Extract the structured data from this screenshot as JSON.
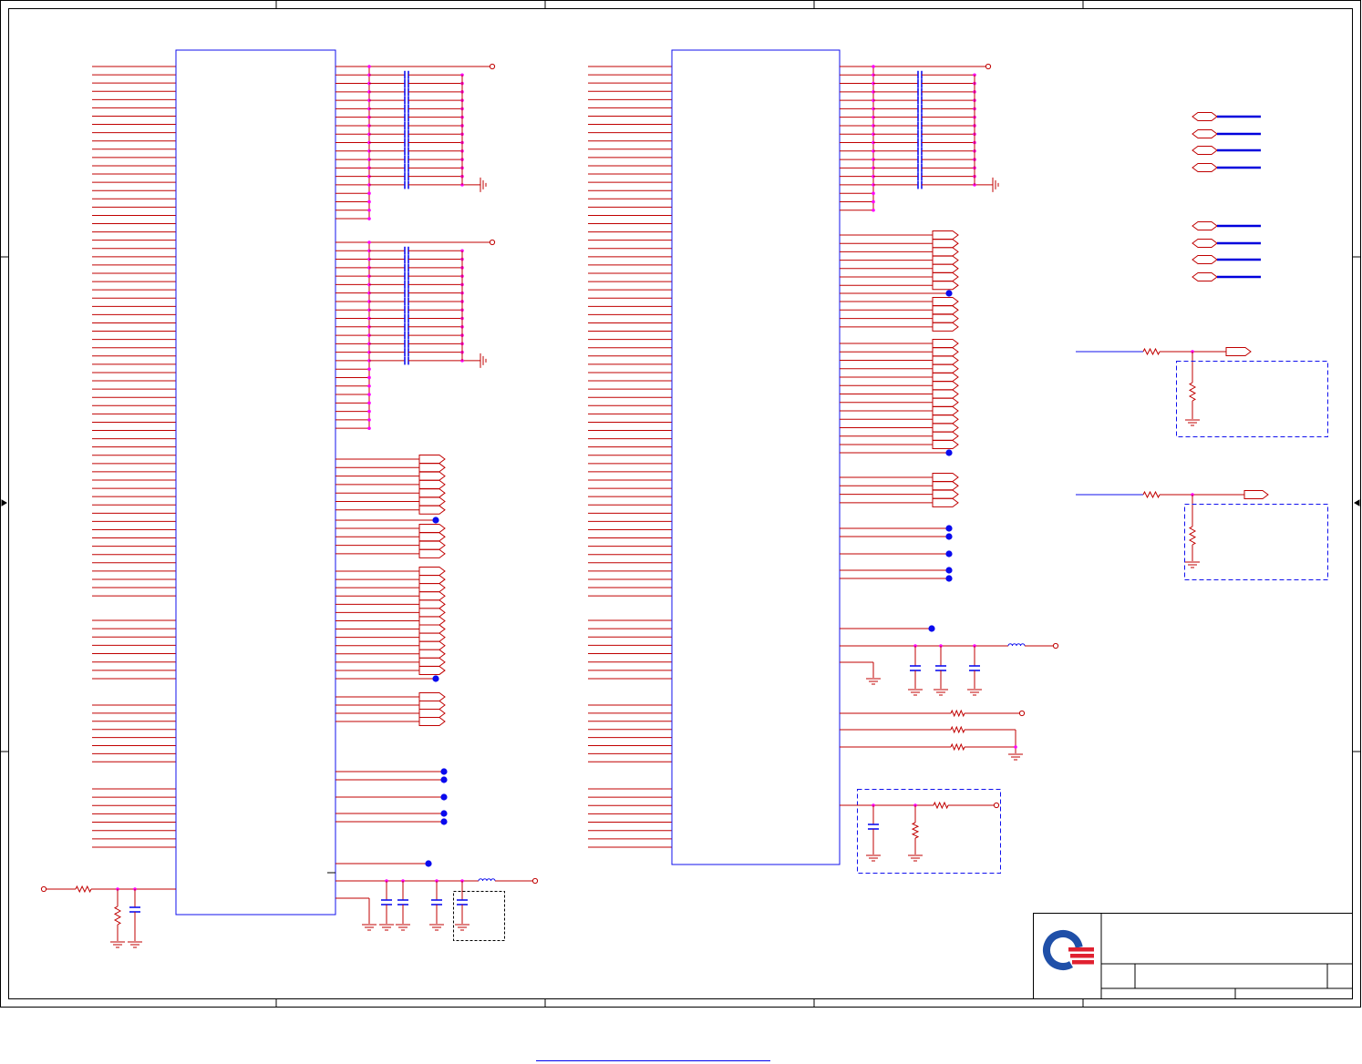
{
  "colors": {
    "wire": "#c00000",
    "component_outline": "#1010ee",
    "junction": "#ff00ff",
    "no_connect_dot": "#0a0aee",
    "net_label_line": "#0000dd",
    "frame": "#000000",
    "logo_blue": "#1f4fa8",
    "logo_red": "#e02030",
    "link_underline": "#0000ee"
  },
  "icons": {
    "ground": "ground-icon",
    "capacitor": "capacitor-icon",
    "resistor": "resistor-icon",
    "inductor": "inductor-icon",
    "port": "port-icon",
    "power_terminal": "power-terminal-icon",
    "logo": "logo-icon"
  }
}
